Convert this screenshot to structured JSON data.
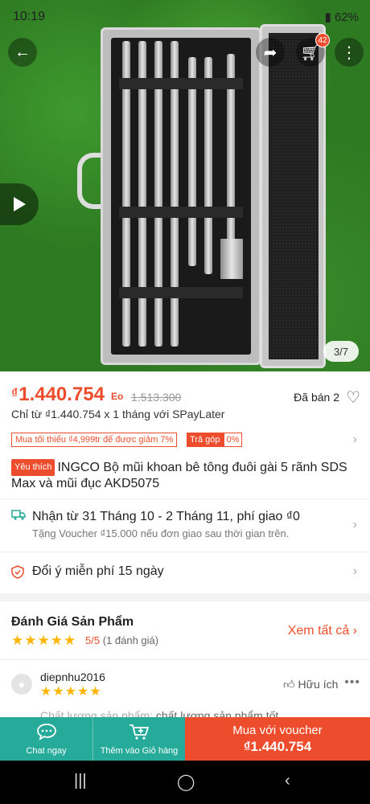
{
  "status_bar": {
    "time": "10:19",
    "battery": "62%"
  },
  "gallery": {
    "counter": "3/7"
  },
  "header": {
    "cart_count": "42"
  },
  "icons": {
    "back": "arrow-left-icon",
    "share": "share-icon",
    "cart": "cart-icon",
    "more": "more-vertical-icon",
    "play": "play-icon",
    "heart": "heart-icon",
    "truck": "truck-icon",
    "shield": "shield-icon",
    "chat": "chat-icon",
    "add_cart": "add-to-cart-icon",
    "thumb": "thumbs-up-icon"
  },
  "colors": {
    "brand": "#ee4d2d",
    "teal": "#26aa99",
    "star": "#ffb400"
  },
  "product": {
    "currency": "₫",
    "price": "1.440.754",
    "discount_badge": "Eo",
    "old_price": "1.513.300",
    "sold": "Đã bán 2",
    "installment": "Chỉ từ ₫1.440.754 x 1 tháng với SPayLater",
    "promo_tag": "Mua tối thiểu ₫4,999tr để được giảm 7%",
    "installment_tag_label": "Trả góp",
    "installment_tag_value": "0%",
    "favorite_label": "Yêu thích",
    "title": "INGCO Bộ mũi khoan bê tông đuôi gài 5 rãnh SDS Max và mũi đục AKD5075"
  },
  "shipping": {
    "line1": "Nhận từ 31 Tháng 10 - 2 Tháng 11, phí giao ₫0",
    "line2": "Tặng Voucher ₫15.000 nếu đơn giao sau thời gian trên."
  },
  "return_policy": "Đổi ý miễn phí 15 ngày",
  "reviews": {
    "title": "Đánh Giá Sản Phẩm",
    "stars": "★★★★★",
    "score": "5/5",
    "count": "(1 đánh giá)",
    "see_all": "Xem tất cả",
    "item": {
      "user": "diepnhu2016",
      "stars": "★★★★★",
      "helpful": "Hữu ích",
      "text_label": "Chất lượng sản phẩm:",
      "text_value": "chất lượng sản phẩm tốt"
    }
  },
  "bottom_bar": {
    "chat": "Chat ngay",
    "add_cart": "Thêm vào Giỏ hàng",
    "buy_line1": "Mua với voucher",
    "buy_line2": "₫1.440.754"
  }
}
